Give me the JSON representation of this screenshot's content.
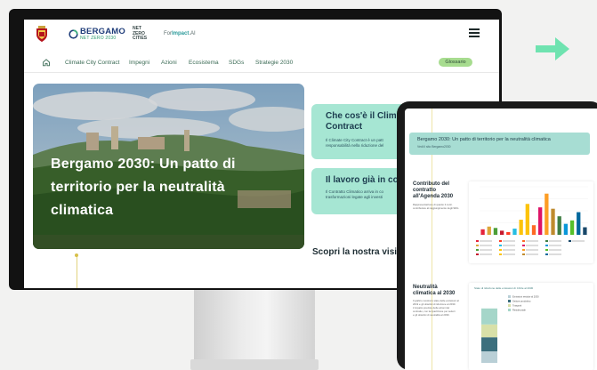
{
  "header": {
    "crest_caption": "",
    "logo_word": "BERGAMO",
    "logo_sub": "NET ZERO 2030",
    "nzc_lines": [
      "NET",
      "ZERO",
      "CITIES"
    ],
    "forimpact_pre": "For",
    "forimpact_bold": "Impact",
    "forimpact_post": ".AI"
  },
  "nav": {
    "items": [
      "Climate City Contract",
      "Impegni",
      "Azioni",
      "Ecosistema",
      "SDGs",
      "Strategie 2030"
    ],
    "glossary": "Glossario"
  },
  "hero": {
    "title": "Bergamo 2030: Un patto di territorio per la neutralità climatica"
  },
  "cards": [
    {
      "title": "Che cos'è il Clim... Contract",
      "title_l1": "Che cos'è il Clim",
      "title_l2": "Contract",
      "text_l1": "Il Climate City Contract è un patt",
      "text_l2": "responsabilità nella riduzione del"
    },
    {
      "title_l1": "Il lavoro già in co",
      "text_l1": "Il Contratto Climatico arriva in co",
      "text_l2": "trasformazioni legate agli investi"
    }
  ],
  "scopri": "Scopri la nostra visi",
  "tablet": {
    "banner_title": "Bergamo 2030: Un patto di territorio per la neutralità climatica",
    "banner_sub": "Vedi il sito Bergamo2030",
    "sec1_title": [
      "Contributo del",
      "contratto",
      "all'Agenda 2030"
    ],
    "sec1_text": [
      "Rappresentazione di quanto il contr.",
      "contribuisce al raggiungimento degli SDG"
    ],
    "sec2_title": [
      "Neutralità",
      "climatica al 2030"
    ],
    "sec2_text": [
      "Il grafico mostra lo stato delle emissioni al",
      "2019 e gli obiettivi di riduzione al 2030.",
      "L'impatto previsto delle azioni del",
      "contratto, con la ripartizione per settori",
      "e gli obiettivi di neutralità al 2030."
    ]
  },
  "chart_data": [
    {
      "type": "bar",
      "title": "",
      "categories": [
        "1",
        "2",
        "3",
        "4",
        "5",
        "6",
        "7",
        "8",
        "9",
        "10",
        "11",
        "12",
        "13",
        "14",
        "15",
        "16",
        "17"
      ],
      "values": [
        8,
        12,
        10,
        6,
        4,
        9,
        22,
        45,
        14,
        40,
        60,
        38,
        27,
        16,
        21,
        33,
        11
      ],
      "colors": [
        "#e5243b",
        "#dda63a",
        "#4c9f38",
        "#c5192d",
        "#ff3a21",
        "#26bde2",
        "#fcc30b",
        "#fcc30b",
        "#fd6925",
        "#dd1367",
        "#fd9d24",
        "#bf8b2e",
        "#3f7e44",
        "#0a97d9",
        "#56c02b",
        "#00689d",
        "#19486a"
      ],
      "ylim": [
        0,
        70
      ]
    },
    {
      "type": "bar",
      "title": "Stato di riduzione delle emissioni di CO2e al 2030",
      "categories": [
        "2019",
        "2030"
      ],
      "series": [
        {
          "name": "Emissioni residue al 2030",
          "values": [
            18,
            18
          ]
        },
        {
          "name": "Settore produttivo",
          "values": [
            22,
            0
          ]
        },
        {
          "name": "Trasporti",
          "values": [
            20,
            0
          ]
        },
        {
          "name": "Residenziale",
          "values": [
            25,
            0
          ]
        }
      ],
      "ylim": [
        0,
        100
      ]
    }
  ],
  "colors": {
    "accent": "#a6e6d3",
    "glossary": "#a7dc8f",
    "arrow": "#6fe3b0",
    "brand": "#1f3d7a"
  }
}
